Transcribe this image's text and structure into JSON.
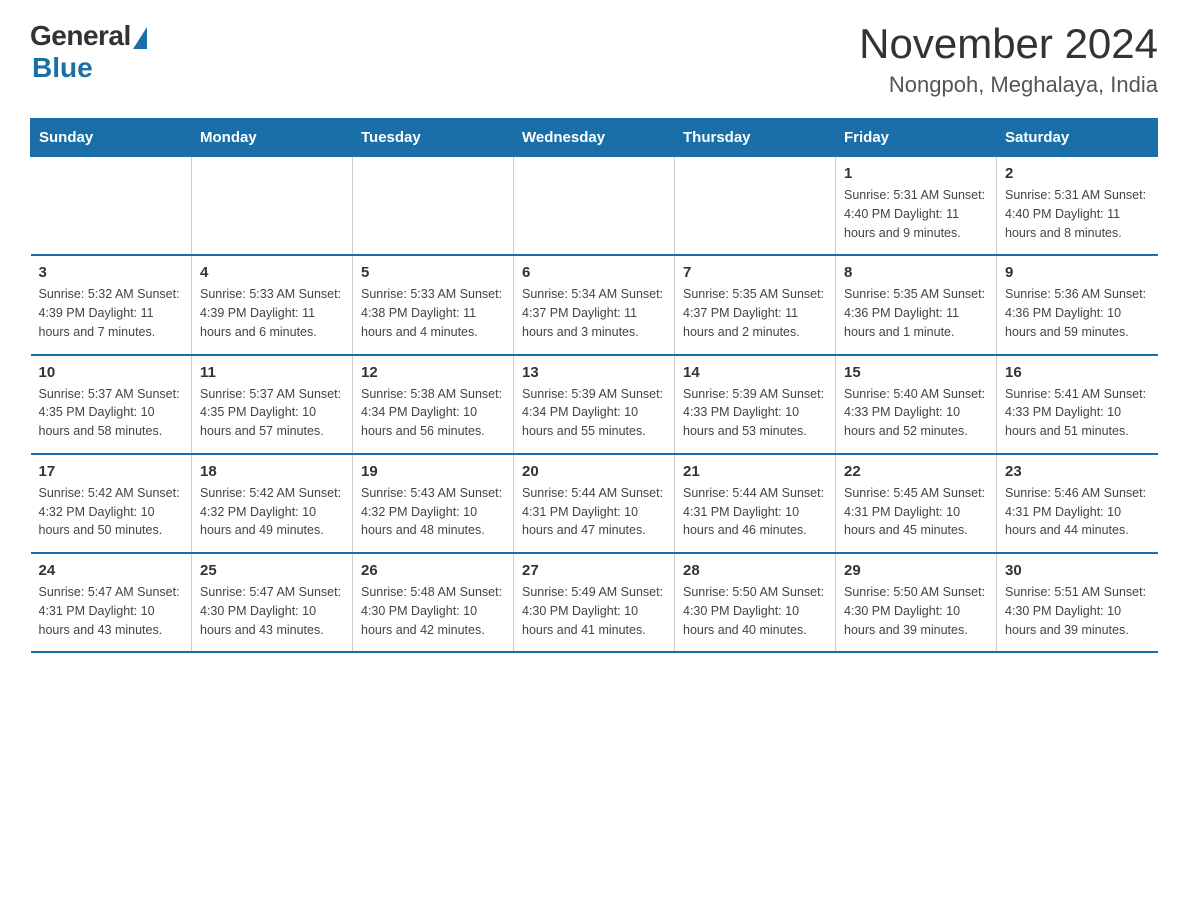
{
  "header": {
    "logo_general": "General",
    "logo_blue": "Blue",
    "title": "November 2024",
    "subtitle": "Nongpoh, Meghalaya, India"
  },
  "weekdays": [
    "Sunday",
    "Monday",
    "Tuesday",
    "Wednesday",
    "Thursday",
    "Friday",
    "Saturday"
  ],
  "weeks": [
    [
      {
        "day": "",
        "info": ""
      },
      {
        "day": "",
        "info": ""
      },
      {
        "day": "",
        "info": ""
      },
      {
        "day": "",
        "info": ""
      },
      {
        "day": "",
        "info": ""
      },
      {
        "day": "1",
        "info": "Sunrise: 5:31 AM\nSunset: 4:40 PM\nDaylight: 11 hours and 9 minutes."
      },
      {
        "day": "2",
        "info": "Sunrise: 5:31 AM\nSunset: 4:40 PM\nDaylight: 11 hours and 8 minutes."
      }
    ],
    [
      {
        "day": "3",
        "info": "Sunrise: 5:32 AM\nSunset: 4:39 PM\nDaylight: 11 hours and 7 minutes."
      },
      {
        "day": "4",
        "info": "Sunrise: 5:33 AM\nSunset: 4:39 PM\nDaylight: 11 hours and 6 minutes."
      },
      {
        "day": "5",
        "info": "Sunrise: 5:33 AM\nSunset: 4:38 PM\nDaylight: 11 hours and 4 minutes."
      },
      {
        "day": "6",
        "info": "Sunrise: 5:34 AM\nSunset: 4:37 PM\nDaylight: 11 hours and 3 minutes."
      },
      {
        "day": "7",
        "info": "Sunrise: 5:35 AM\nSunset: 4:37 PM\nDaylight: 11 hours and 2 minutes."
      },
      {
        "day": "8",
        "info": "Sunrise: 5:35 AM\nSunset: 4:36 PM\nDaylight: 11 hours and 1 minute."
      },
      {
        "day": "9",
        "info": "Sunrise: 5:36 AM\nSunset: 4:36 PM\nDaylight: 10 hours and 59 minutes."
      }
    ],
    [
      {
        "day": "10",
        "info": "Sunrise: 5:37 AM\nSunset: 4:35 PM\nDaylight: 10 hours and 58 minutes."
      },
      {
        "day": "11",
        "info": "Sunrise: 5:37 AM\nSunset: 4:35 PM\nDaylight: 10 hours and 57 minutes."
      },
      {
        "day": "12",
        "info": "Sunrise: 5:38 AM\nSunset: 4:34 PM\nDaylight: 10 hours and 56 minutes."
      },
      {
        "day": "13",
        "info": "Sunrise: 5:39 AM\nSunset: 4:34 PM\nDaylight: 10 hours and 55 minutes."
      },
      {
        "day": "14",
        "info": "Sunrise: 5:39 AM\nSunset: 4:33 PM\nDaylight: 10 hours and 53 minutes."
      },
      {
        "day": "15",
        "info": "Sunrise: 5:40 AM\nSunset: 4:33 PM\nDaylight: 10 hours and 52 minutes."
      },
      {
        "day": "16",
        "info": "Sunrise: 5:41 AM\nSunset: 4:33 PM\nDaylight: 10 hours and 51 minutes."
      }
    ],
    [
      {
        "day": "17",
        "info": "Sunrise: 5:42 AM\nSunset: 4:32 PM\nDaylight: 10 hours and 50 minutes."
      },
      {
        "day": "18",
        "info": "Sunrise: 5:42 AM\nSunset: 4:32 PM\nDaylight: 10 hours and 49 minutes."
      },
      {
        "day": "19",
        "info": "Sunrise: 5:43 AM\nSunset: 4:32 PM\nDaylight: 10 hours and 48 minutes."
      },
      {
        "day": "20",
        "info": "Sunrise: 5:44 AM\nSunset: 4:31 PM\nDaylight: 10 hours and 47 minutes."
      },
      {
        "day": "21",
        "info": "Sunrise: 5:44 AM\nSunset: 4:31 PM\nDaylight: 10 hours and 46 minutes."
      },
      {
        "day": "22",
        "info": "Sunrise: 5:45 AM\nSunset: 4:31 PM\nDaylight: 10 hours and 45 minutes."
      },
      {
        "day": "23",
        "info": "Sunrise: 5:46 AM\nSunset: 4:31 PM\nDaylight: 10 hours and 44 minutes."
      }
    ],
    [
      {
        "day": "24",
        "info": "Sunrise: 5:47 AM\nSunset: 4:31 PM\nDaylight: 10 hours and 43 minutes."
      },
      {
        "day": "25",
        "info": "Sunrise: 5:47 AM\nSunset: 4:30 PM\nDaylight: 10 hours and 43 minutes."
      },
      {
        "day": "26",
        "info": "Sunrise: 5:48 AM\nSunset: 4:30 PM\nDaylight: 10 hours and 42 minutes."
      },
      {
        "day": "27",
        "info": "Sunrise: 5:49 AM\nSunset: 4:30 PM\nDaylight: 10 hours and 41 minutes."
      },
      {
        "day": "28",
        "info": "Sunrise: 5:50 AM\nSunset: 4:30 PM\nDaylight: 10 hours and 40 minutes."
      },
      {
        "day": "29",
        "info": "Sunrise: 5:50 AM\nSunset: 4:30 PM\nDaylight: 10 hours and 39 minutes."
      },
      {
        "day": "30",
        "info": "Sunrise: 5:51 AM\nSunset: 4:30 PM\nDaylight: 10 hours and 39 minutes."
      }
    ]
  ]
}
